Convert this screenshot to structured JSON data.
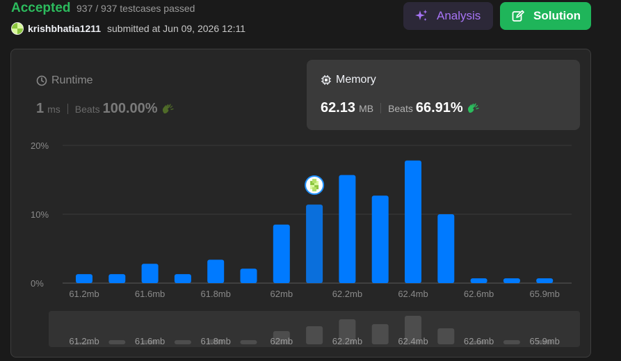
{
  "header": {
    "status": "Accepted",
    "testcases": "937 / 937 testcases passed",
    "username": "krishbhatia1211",
    "submitted": "submitted at Jun 09, 2026 12:11",
    "analysis_label": "Analysis",
    "solution_label": "Solution"
  },
  "runtime": {
    "title": "Runtime",
    "value": "1",
    "unit": "ms",
    "beats_label": "Beats",
    "beats": "100.00%"
  },
  "memory": {
    "title": "Memory",
    "value": "62.13",
    "unit": "MB",
    "beats_label": "Beats",
    "beats": "66.91%"
  },
  "colors": {
    "accepted": "#2cbb5d",
    "bar": "#007aff",
    "bar_highlight": "#0a6fdc",
    "solution_button": "#1fb55a",
    "analysis_text": "#a774f5"
  },
  "chart_data": {
    "type": "bar",
    "ylim": [
      0,
      20
    ],
    "yticks": [
      "0%",
      "10%",
      "20%"
    ],
    "ytick_values": [
      0,
      10,
      20
    ],
    "highlight_index": 7,
    "values": [
      1.3,
      1.3,
      2.8,
      1.3,
      3.4,
      2.1,
      8.5,
      11.4,
      15.7,
      12.7,
      17.8,
      10.0,
      0.7,
      0.7,
      0.7
    ],
    "xtick_labels": [
      "61.2mb",
      "61.6mb",
      "61.8mb",
      "62mb",
      "62.2mb",
      "62.4mb",
      "62.6mb",
      "65.9mb"
    ],
    "overview_values": [
      0.3,
      0.6,
      0.6,
      0.6,
      0.7,
      0.6,
      1.9,
      2.6,
      3.6,
      2.9,
      4.1,
      2.3,
      0.5,
      0.6,
      0.6
    ]
  }
}
